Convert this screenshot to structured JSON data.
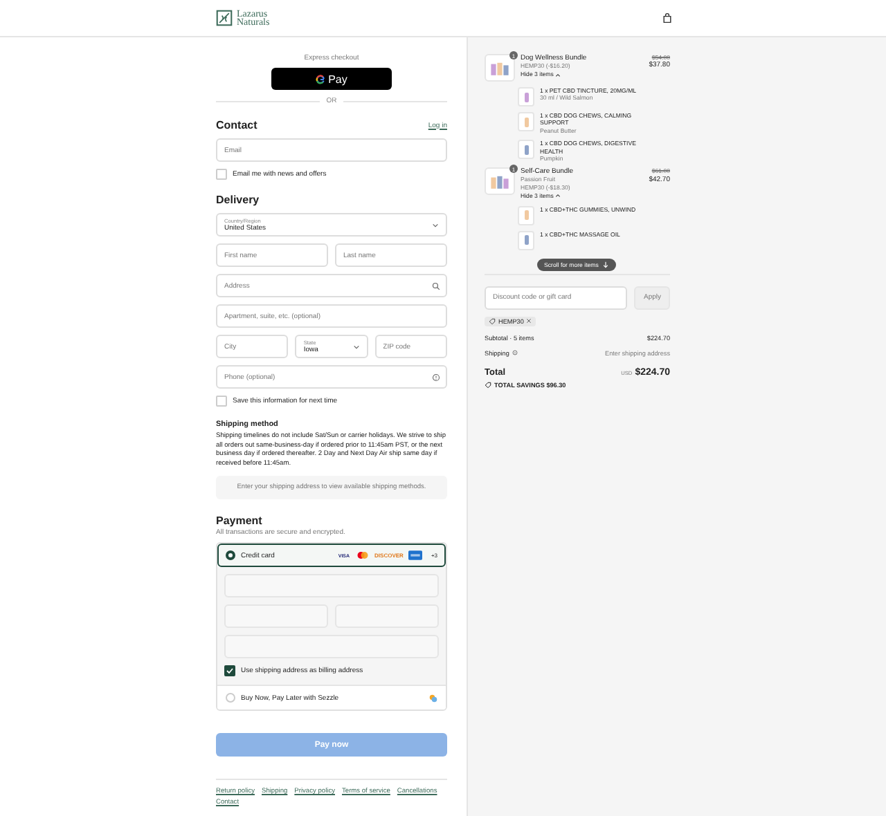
{
  "header": {
    "logo_top": "Lazarus",
    "logo_bottom": "Naturals"
  },
  "express": {
    "label": "Express checkout",
    "gpay": "Pay",
    "or": "OR"
  },
  "contact": {
    "title": "Contact",
    "login": "Log in",
    "email": {
      "placeholder": "Email"
    },
    "newsletter": {
      "label": "Email me with news and offers",
      "checked": false
    }
  },
  "delivery": {
    "title": "Delivery",
    "country": {
      "label": "Country/Region",
      "value": "United States"
    },
    "first_name": {
      "placeholder": "First name"
    },
    "last_name": {
      "placeholder": "Last name"
    },
    "address": {
      "placeholder": "Address"
    },
    "apartment": {
      "placeholder": "Apartment, suite, etc. (optional)"
    },
    "city": {
      "placeholder": "City"
    },
    "state": {
      "label": "State",
      "value": "Iowa"
    },
    "zip": {
      "placeholder": "ZIP code"
    },
    "phone": {
      "placeholder": "Phone (optional)"
    },
    "save": {
      "label": "Save this information for next time",
      "checked": false
    }
  },
  "shipping_method": {
    "title": "Shipping method",
    "text": "Shipping timelines do not include Sat/Sun or carrier holidays. We strive to ship all orders out same-business-day if ordered prior to 11:45am PST, or the next business day if ordered thereafter. 2 Day and Next Day Air ship same day if received before 11:45am.",
    "notice": "Enter your shipping address to view available shipping methods."
  },
  "payment": {
    "title": "Payment",
    "subtitle": "All transactions are secure and encrypted.",
    "methods": [
      {
        "kind": "card",
        "label": "Credit card",
        "selected": true,
        "visa": "VISA",
        "discover": "DISCOVER",
        "more": "+3"
      },
      {
        "kind": "sezzle",
        "label": "Buy Now, Pay Later with Sezzle",
        "selected": false
      }
    ],
    "billing": {
      "label": "Use shipping address as billing address",
      "checked": true
    }
  },
  "pay_button": {
    "label": "Pay now",
    "disabled": true
  },
  "footer_links": [
    "Return policy",
    "Shipping",
    "Privacy policy",
    "Terms of service",
    "Cancellations",
    "Contact"
  ],
  "order": {
    "bundles": [
      {
        "name": "Dog Wellness Bundle",
        "quantity": "1",
        "discount": "HEMP30 (-$16.20)",
        "old_price": "$54.00",
        "price": "$37.80",
        "toggle": "Hide 3 items",
        "items": [
          {
            "name": "1 x PET CBD TINCTURE, 20MG/ML",
            "variant": "30 ml / Wild Salmon"
          },
          {
            "name": "1 x CBD DOG CHEWS, CALMING SUPPORT",
            "variant": "Peanut Butter"
          },
          {
            "name": "1 x CBD DOG CHEWS, DIGESTIVE HEALTH",
            "variant": "Pumpkin"
          }
        ]
      },
      {
        "name": "Self-Care Bundle",
        "variant": "Passion Fruit",
        "quantity": "1",
        "discount": "HEMP30 (-$18.30)",
        "old_price": "$61.00",
        "price": "$42.70",
        "toggle": "Hide 3 items",
        "items": [
          {
            "name": "1 x CBD+THC GUMMIES, UNWIND"
          },
          {
            "name": "1 x CBD+THC MASSAGE OIL"
          }
        ]
      }
    ],
    "scroll_hint": "Scroll for more items",
    "discount_field": {
      "placeholder": "Discount code or gift card"
    },
    "apply": "Apply",
    "code": "HEMP30",
    "subtotal_label": "Subtotal · 5 items",
    "subtotal": "$224.70",
    "shipping_label": "Shipping",
    "shipping_value": "Enter shipping address",
    "total_label": "Total",
    "currency": "USD",
    "total": "$224.70",
    "savings": "TOTAL SAVINGS $96.30"
  }
}
